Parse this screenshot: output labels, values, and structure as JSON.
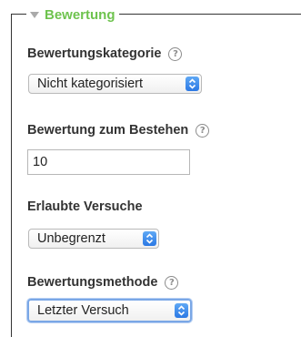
{
  "section": {
    "legend": "Bewertung"
  },
  "fields": {
    "category": {
      "label": "Bewertungskategorie",
      "selected": "Nicht kategorisiert"
    },
    "pass_grade": {
      "label": "Bewertung zum Bestehen",
      "value": "10"
    },
    "attempts": {
      "label": "Erlaubte Versuche",
      "selected": "Unbegrenzt"
    },
    "method": {
      "label": "Bewertungsmethode",
      "selected": "Letzter Versuch"
    }
  },
  "help_glyph": "?",
  "colors": {
    "legend_green": "#6ec34e",
    "select_arrow_blue": "#2b78e4",
    "focus_ring": "#7aa7e6"
  }
}
